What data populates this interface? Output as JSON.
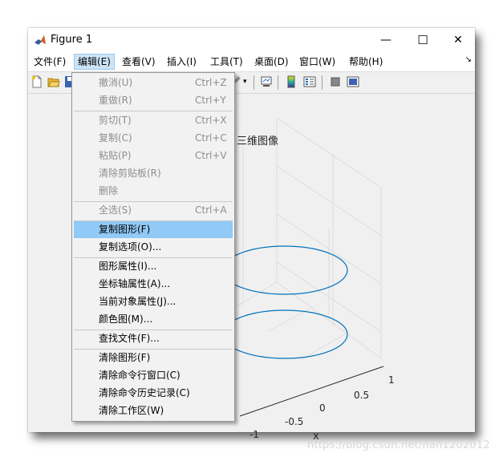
{
  "window": {
    "title": "Figure 1",
    "controls": {
      "minimize": "—",
      "maximize": "☐",
      "close": "✕"
    }
  },
  "menubar": {
    "items": [
      {
        "label": "文件(F)"
      },
      {
        "label": "编辑(E)"
      },
      {
        "label": "查看(V)"
      },
      {
        "label": "插入(I)"
      },
      {
        "label": "工具(T)"
      },
      {
        "label": "桌面(D)"
      },
      {
        "label": "窗口(W)"
      },
      {
        "label": "帮助(H)"
      }
    ],
    "overflow": "↘"
  },
  "toolbar": {
    "icons": [
      "new-figure-icon",
      "open-file-icon",
      "save-icon",
      "brush-icon",
      "dropdown-arrow-icon",
      "link-plot-icon",
      "colorbar-icon",
      "legend-icon",
      "hide-plot-tools-icon",
      "show-plot-tools-icon"
    ],
    "arrow": "▾"
  },
  "edit_menu": {
    "items": [
      {
        "label": "撤消(U)",
        "shortcut": "Ctrl+Z",
        "enabled": false
      },
      {
        "label": "重做(R)",
        "shortcut": "Ctrl+Y",
        "enabled": false
      },
      {
        "label": "剪切(T)",
        "shortcut": "Ctrl+X",
        "enabled": false
      },
      {
        "label": "复制(C)",
        "shortcut": "Ctrl+C",
        "enabled": false
      },
      {
        "label": "粘贴(P)",
        "shortcut": "Ctrl+V",
        "enabled": false
      },
      {
        "label": "清除剪贴板(R)",
        "shortcut": "",
        "enabled": false
      },
      {
        "label": "删除",
        "shortcut": "",
        "enabled": false
      },
      {
        "label": "全选(S)",
        "shortcut": "Ctrl+A",
        "enabled": false
      },
      {
        "label": "复制图形(F)",
        "shortcut": "",
        "enabled": true,
        "highlighted": true
      },
      {
        "label": "复制选项(O)...",
        "shortcut": "",
        "enabled": true
      },
      {
        "label": "图形属性(I)...",
        "shortcut": "",
        "enabled": true
      },
      {
        "label": "坐标轴属性(A)...",
        "shortcut": "",
        "enabled": true
      },
      {
        "label": "当前对象属性(J)...",
        "shortcut": "",
        "enabled": true
      },
      {
        "label": "颜色图(M)...",
        "shortcut": "",
        "enabled": true
      },
      {
        "label": "查找文件(F)...",
        "shortcut": "",
        "enabled": true
      },
      {
        "label": "清除图形(F)",
        "shortcut": "",
        "enabled": true
      },
      {
        "label": "清除命令行窗口(C)",
        "shortcut": "",
        "enabled": true
      },
      {
        "label": "清除命令历史记录(C)",
        "shortcut": "",
        "enabled": true
      },
      {
        "label": "清除工作区(W)",
        "shortcut": "",
        "enabled": true
      }
    ]
  },
  "plot": {
    "title": "三维图像",
    "x_axis_label": "x",
    "x_ticks": [
      "1",
      "0.5",
      "0",
      "-0.5",
      "-1"
    ],
    "line_color": "#0072bd",
    "grid_color": "#dcdcdc"
  },
  "watermark": "https://blog.csdn.net/han1202012"
}
